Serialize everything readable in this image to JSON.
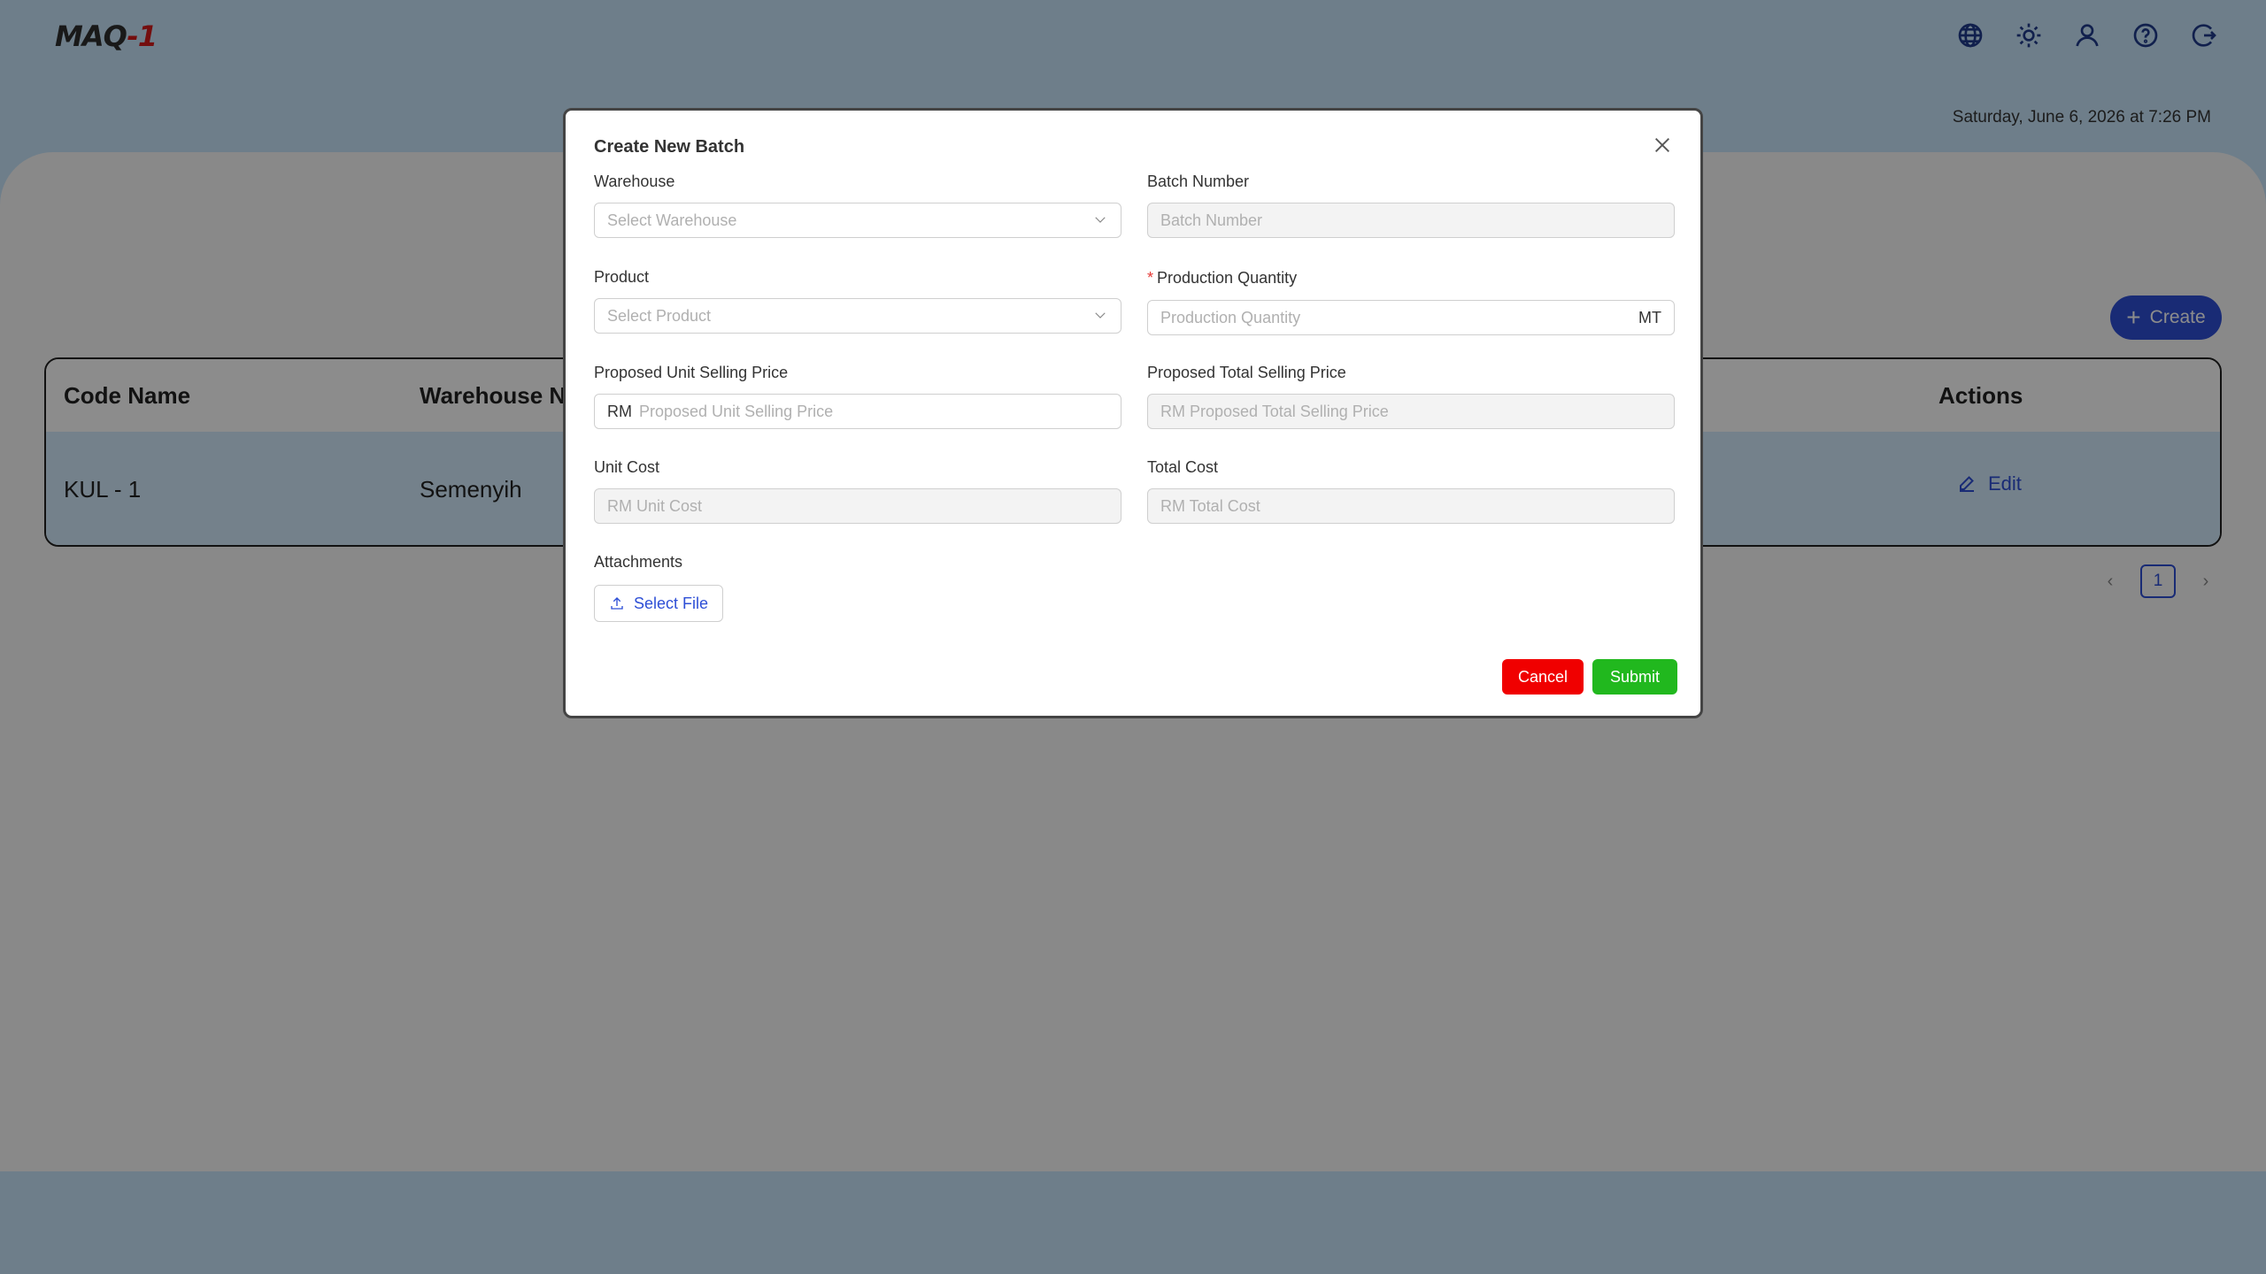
{
  "app": {
    "logo_prefix": "MAQ",
    "logo_suffix": "-1",
    "datetime": "Saturday, June 6, 2026 at 7:26 PM",
    "top_icons": [
      "globe-icon",
      "sun-icon",
      "user-icon",
      "help-icon",
      "logout-icon"
    ]
  },
  "page": {
    "create_label": "Create",
    "table": {
      "headers": [
        "Code Name",
        "Warehouse Na",
        "Actions"
      ],
      "rows": [
        {
          "code_name": "KUL - 1",
          "warehouse": "Semenyih",
          "action": "Edit"
        }
      ]
    },
    "pagination": {
      "current_page": "1",
      "prev": "‹",
      "next": "›"
    }
  },
  "modal": {
    "title": "Create New Batch",
    "warehouse": {
      "label": "Warehouse",
      "placeholder": "Select Warehouse"
    },
    "batch_number": {
      "label": "Batch Number",
      "placeholder": "Batch Number"
    },
    "product": {
      "label": "Product",
      "placeholder": "Select Product"
    },
    "production_quantity": {
      "label": "Production Quantity",
      "placeholder": "Production Quantity",
      "suffix": "MT",
      "required_mark": "*"
    },
    "proposed_unit_selling_price": {
      "label": "Proposed Unit Selling Price",
      "prefix": "RM",
      "placeholder": "Proposed Unit Selling Price"
    },
    "proposed_total_selling_price": {
      "label": "Proposed Total Selling Price",
      "placeholder": "RM Proposed Total Selling Price"
    },
    "unit_cost": {
      "label": "Unit Cost",
      "placeholder": "RM Unit Cost"
    },
    "total_cost": {
      "label": "Total Cost",
      "placeholder": "RM Total Cost"
    },
    "attachments": {
      "label": "Attachments",
      "button": "Select File"
    },
    "cancel_label": "Cancel",
    "submit_label": "Submit"
  },
  "colors": {
    "accent": "#2e4fd6",
    "cancel": "#f00000",
    "submit": "#21b81e",
    "header_bg": "#c9e6fb",
    "row_bg": "#d4ecfd"
  }
}
